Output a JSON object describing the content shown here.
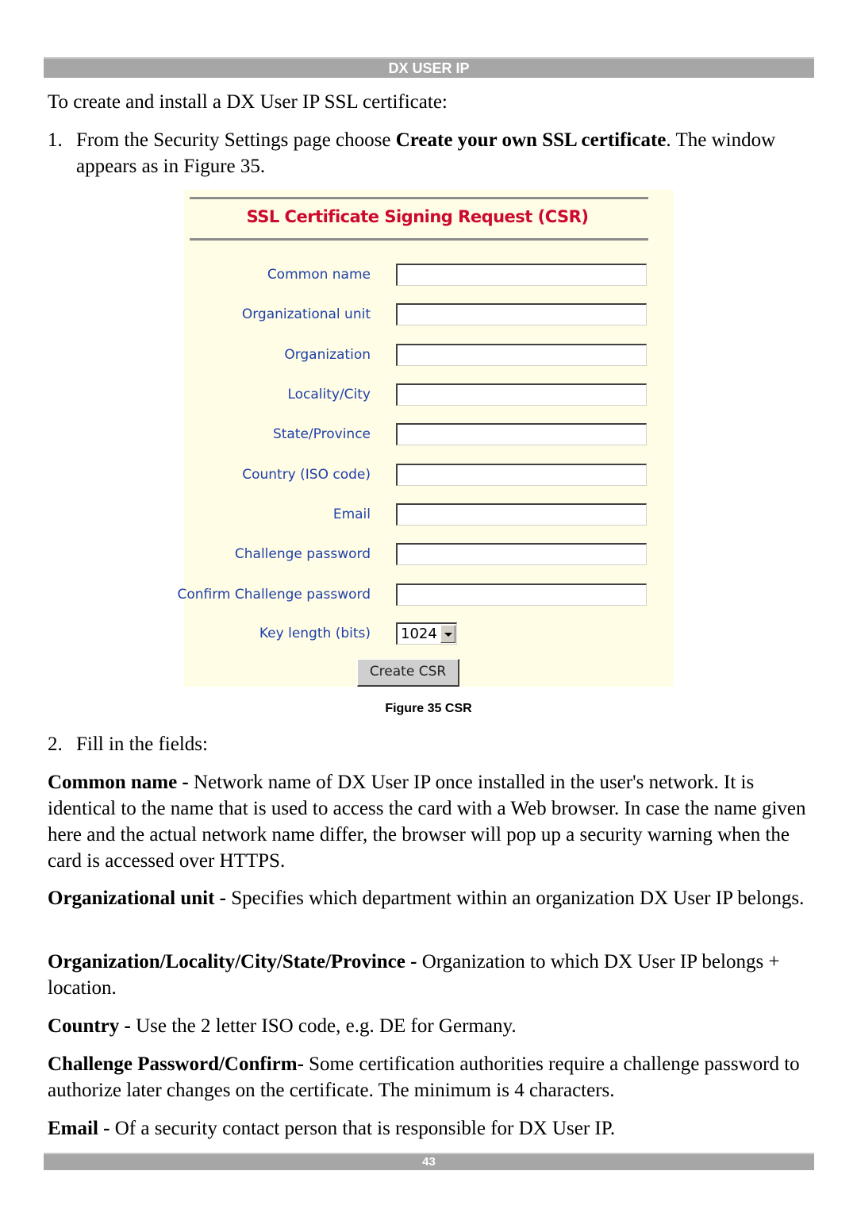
{
  "header": {
    "title": "DX USER IP"
  },
  "intro": "To create and install a DX User IP SSL certificate:",
  "step1": {
    "number": "1.",
    "text_before": "From the Security Settings page choose ",
    "bold": "Create your own SSL certificate",
    "text_after": ". The window appears as in Figure 35."
  },
  "figure": {
    "title": "SSL Certificate Signing Request (CSR)",
    "fields": [
      {
        "label": "Common name",
        "value": ""
      },
      {
        "label": "Organizational unit",
        "value": ""
      },
      {
        "label": "Organization",
        "value": ""
      },
      {
        "label": "Locality/City",
        "value": ""
      },
      {
        "label": "State/Province",
        "value": ""
      },
      {
        "label": "Country (ISO code)",
        "value": ""
      },
      {
        "label": "Email",
        "value": ""
      },
      {
        "label": "Challenge password",
        "value": ""
      },
      {
        "label": "Confirm Challenge password",
        "value": ""
      }
    ],
    "key_length": {
      "label": "Key length (bits)",
      "selected": "1024"
    },
    "submit_label": "Create CSR",
    "caption": "Figure 35 CSR"
  },
  "step2": {
    "number": "2.",
    "text": "Fill in the fields:"
  },
  "definitions": [
    {
      "term": "Common name - ",
      "text": "Network name of DX User IP once installed in the user's network. It is identical to the name that is used to access the card with a Web browser. In case the name given here and the actual network name differ, the browser will pop up a security warning when the card is accessed over HTTPS."
    },
    {
      "term": "Organizational unit - ",
      "text": "Specifies which department within an organization DX User IP belongs."
    },
    {
      "term": "Organization/Locality/City/State/Province - ",
      "text": "Organization to which DX User IP belongs + location."
    },
    {
      "term": "Country - ",
      "text": "Use the 2 letter ISO code, e.g. DE for Germany."
    },
    {
      "term": "Challenge Password/Confirm- ",
      "text": "Some certification authorities require a challenge password to authorize later changes on the certificate. The minimum is 4 characters."
    },
    {
      "term": "Email - ",
      "text": "Of a security contact person that is responsible for DX User IP."
    }
  ],
  "footer": {
    "page_number": "43"
  }
}
